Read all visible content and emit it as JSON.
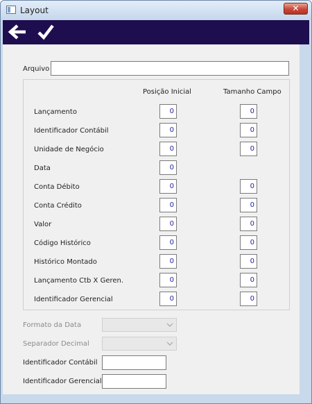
{
  "window": {
    "title": "Layout",
    "close_label": "✕"
  },
  "toolbar": {
    "back_icon": "arrow-left-icon",
    "confirm_icon": "checkmark-icon"
  },
  "form": {
    "arquivo_label": "Arquivo",
    "arquivo_value": "",
    "col_posicao": "Posição Inicial",
    "col_tamanho": "Tamanho Campo",
    "rows": [
      {
        "label": "Lançamento",
        "posicao": "0",
        "tamanho": "0"
      },
      {
        "label": "Identificador Contábil",
        "posicao": "0",
        "tamanho": "0"
      },
      {
        "label": "Unidade de Negócio",
        "posicao": "0",
        "tamanho": "0"
      },
      {
        "label": "Data",
        "posicao": "0",
        "tamanho": null
      },
      {
        "label": "Conta Débito",
        "posicao": "0",
        "tamanho": "0"
      },
      {
        "label": "Conta Crédito",
        "posicao": "0",
        "tamanho": "0"
      },
      {
        "label": "Valor",
        "posicao": "0",
        "tamanho": "0"
      },
      {
        "label": "Código Histórico",
        "posicao": "0",
        "tamanho": "0"
      },
      {
        "label": "Histórico Montado",
        "posicao": "0",
        "tamanho": "0"
      },
      {
        "label": "Lançamento Ctb X Geren.",
        "posicao": "0",
        "tamanho": "0"
      },
      {
        "label": "Identificador Gerencial",
        "posicao": "0",
        "tamanho": "0"
      }
    ],
    "formato_data_label": "Formato da Data",
    "formato_data_value": "",
    "separador_decimal_label": "Separador Decimal",
    "separador_decimal_value": "",
    "ident_contabil_label": "Identificador Contábil",
    "ident_contabil_value": "",
    "ident_gerencial_label": "Identificador Gerencial",
    "ident_gerencial_value": ""
  }
}
